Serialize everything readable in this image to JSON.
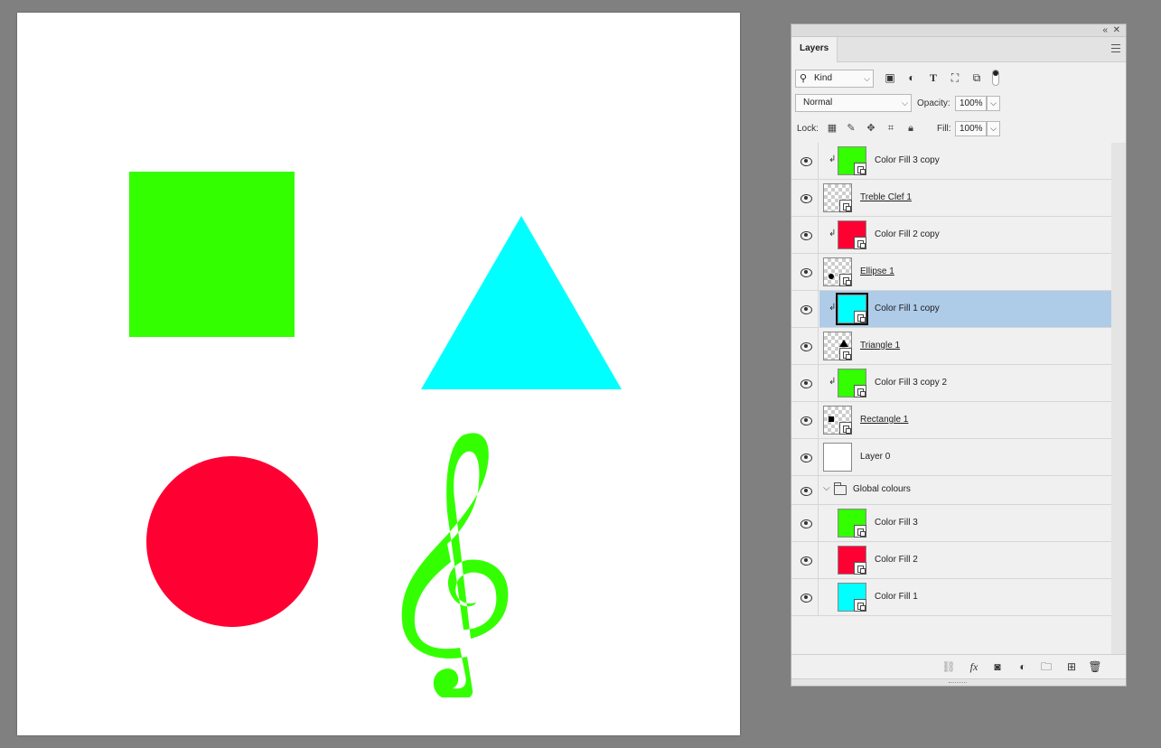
{
  "colors": {
    "green": "#33ff00",
    "red": "#ff0033",
    "cyan": "#00ffff",
    "selected_row": "#aecbe8",
    "workspace": "#808080"
  },
  "panel": {
    "title_tab": "Layers",
    "collapse_icon": "double-chevron-left-icon",
    "close_icon": "close-icon",
    "menu_icon": "panel-menu-icon"
  },
  "filter": {
    "kind_label": "Kind",
    "icons": [
      "image-filter-icon",
      "adjustment-filter-icon",
      "type-filter-icon",
      "shape-filter-icon",
      "smart-object-filter-icon"
    ]
  },
  "blend": {
    "mode": "Normal",
    "opacity_label": "Opacity:",
    "opacity_value": "100%"
  },
  "lock": {
    "label": "Lock:",
    "fill_label": "Fill:",
    "fill_value": "100%"
  },
  "layers": [
    {
      "name": "Color Fill 3 copy",
      "kind": "fill",
      "color": "#33ff00",
      "clipped": true
    },
    {
      "name": "Treble Clef 1",
      "kind": "shape",
      "glyph": "treble-clef"
    },
    {
      "name": "Color Fill 2 copy",
      "kind": "fill",
      "color": "#ff0033",
      "clipped": true
    },
    {
      "name": "Ellipse 1",
      "kind": "shape",
      "glyph": "ellipse"
    },
    {
      "name": "Color Fill 1 copy",
      "kind": "fill",
      "color": "#00ffff",
      "clipped": true,
      "selected": true
    },
    {
      "name": "Triangle 1",
      "kind": "shape",
      "glyph": "triangle"
    },
    {
      "name": "Color Fill 3 copy 2",
      "kind": "fill",
      "color": "#33ff00",
      "clipped": true
    },
    {
      "name": "Rectangle 1",
      "kind": "shape",
      "glyph": "rectangle"
    },
    {
      "name": "Layer 0",
      "kind": "pixel"
    },
    {
      "name": "Global colours",
      "kind": "group"
    },
    {
      "name": "Color Fill 3",
      "kind": "fill",
      "color": "#33ff00",
      "indented": true
    },
    {
      "name": "Color Fill 2",
      "kind": "fill",
      "color": "#ff0033",
      "indented": true
    },
    {
      "name": "Color Fill 1",
      "kind": "fill",
      "color": "#00ffff",
      "indented": true
    }
  ],
  "bottom_icons": [
    "link-layers-icon",
    "fx-icon",
    "add-mask-icon",
    "new-adjustment-icon",
    "new-group-icon",
    "new-layer-icon",
    "delete-layer-icon"
  ]
}
